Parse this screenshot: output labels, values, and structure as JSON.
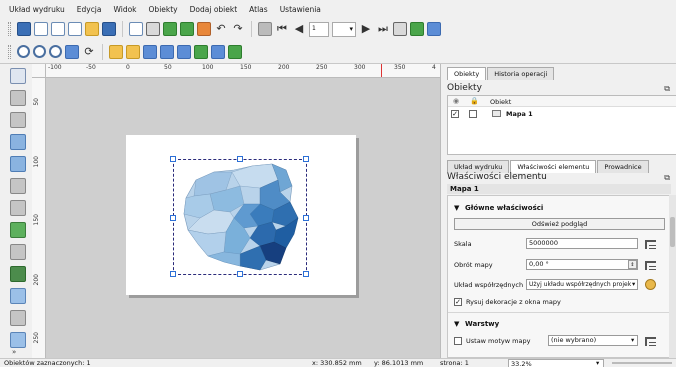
{
  "menu": [
    "Układ wydruku",
    "Edycja",
    "Widok",
    "Obiekty",
    "Dodaj obiekt",
    "Atlas",
    "Ustawienia"
  ],
  "toolbar": {
    "page_number": "1"
  },
  "ruler": {
    "h_labels": [
      "-100",
      "-50",
      "0",
      "50",
      "100",
      "150",
      "200",
      "250",
      "300",
      "350",
      "4"
    ],
    "v_labels": [
      "50",
      "100",
      "150",
      "200",
      "250"
    ]
  },
  "dock": {
    "top_tabs": [
      "Obiekty",
      "Historia operacji"
    ],
    "objects_title": "Obiekty",
    "col_headers": [
      "Obiekt"
    ],
    "objects": [
      {
        "visible": true,
        "locked": false,
        "name": "Mapa 1"
      }
    ],
    "bottom_tabs": [
      "Układ wydruku",
      "Właściwości elementu",
      "Prowadnice"
    ],
    "props_title": "Właściwości elementu",
    "item_name": "Mapa 1",
    "main_section": "Główne właściwości",
    "refresh_button": "Odśwież podgląd",
    "scale_label": "Skala",
    "scale_value": "5000000",
    "rotation_label": "Obrót mapy",
    "rotation_value": "0,00 °",
    "crs_label": "Układ współrzędnych",
    "crs_value": "Użyj układu współrzędnych projek",
    "draw_decor_label": "Rysuj dekoracje z okna mapy",
    "draw_decor_checked": true,
    "layers_section": "Warstwy",
    "theme_label": "Ustaw motyw mapy",
    "theme_value": "(nie wybrano)"
  },
  "status": {
    "selected": "Obiektów zaznaczonych: 1",
    "x": "x: 330.852 mm",
    "y": "y: 86.1013 mm",
    "page": "strona: 1",
    "zoom": "33.2%"
  },
  "colors": {
    "map_light": "#b9d3ea",
    "map_mid": "#6fa6d4",
    "map_dark": "#2f6fb0",
    "map_darkest": "#163f7f",
    "accent": "#2c6fd6"
  }
}
